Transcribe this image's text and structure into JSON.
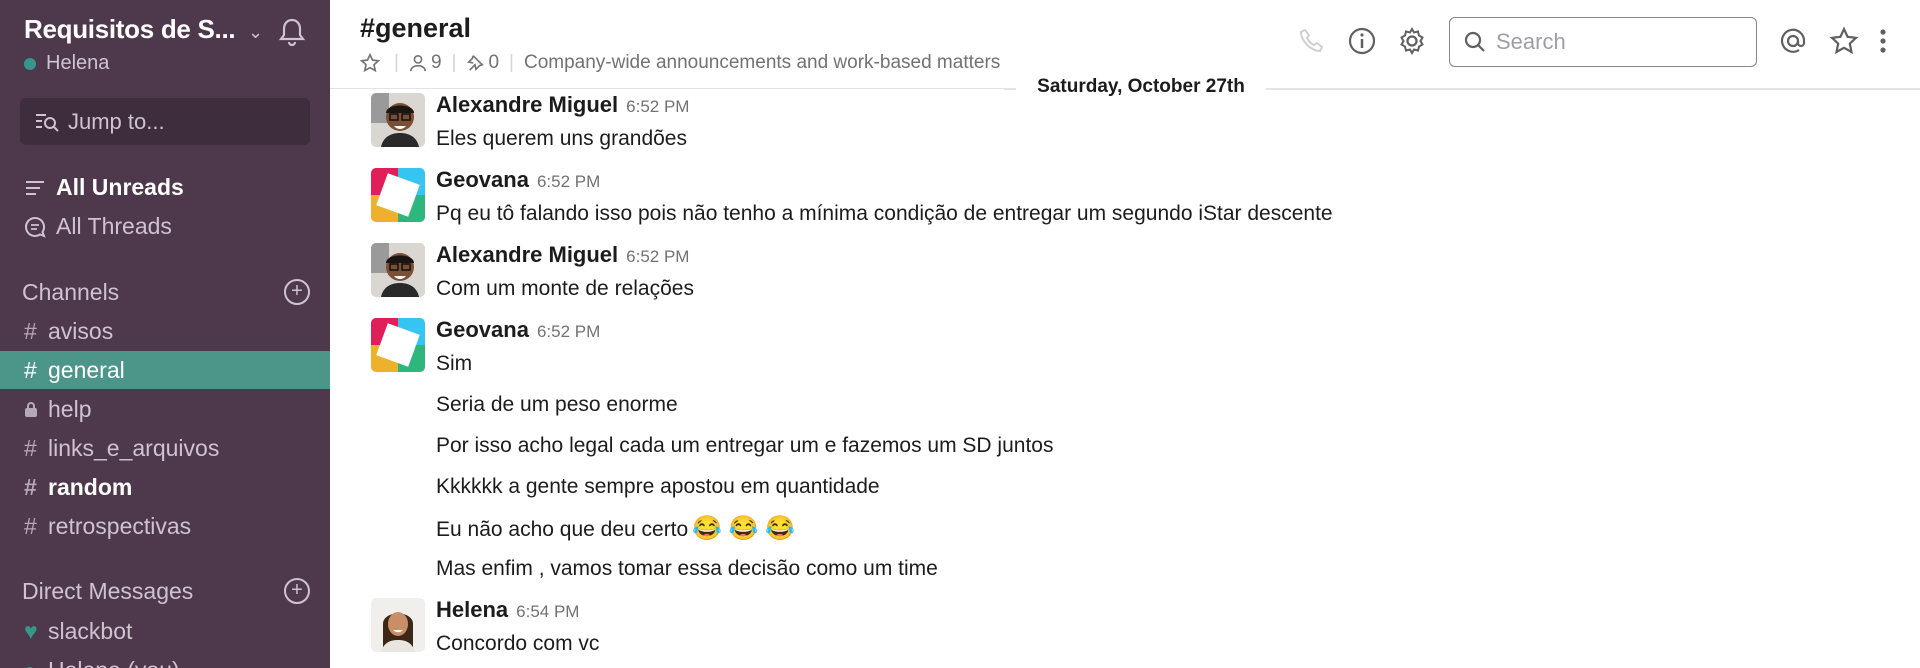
{
  "team": {
    "name": "Requisitos de S...",
    "user": "Helena"
  },
  "jump": {
    "label": "Jump to..."
  },
  "nav": {
    "all_unreads": "All Unreads",
    "all_threads": "All Threads"
  },
  "channels_section": {
    "title": "Channels"
  },
  "channels": [
    {
      "name": "avisos",
      "type": "public",
      "state": "normal"
    },
    {
      "name": "general",
      "type": "public",
      "state": "active"
    },
    {
      "name": "help",
      "type": "private",
      "state": "normal"
    },
    {
      "name": "links_e_arquivos",
      "type": "public",
      "state": "normal"
    },
    {
      "name": "random",
      "type": "public",
      "state": "unread"
    },
    {
      "name": "retrospectivas",
      "type": "public",
      "state": "normal"
    }
  ],
  "dm_section": {
    "title": "Direct Messages"
  },
  "dms": [
    {
      "name": "slackbot",
      "icon": "heart-icon"
    },
    {
      "name": "Helena (you)",
      "icon": "presence-dot"
    }
  ],
  "header": {
    "channel": "#general",
    "members": "9",
    "pins": "0",
    "topic": "Company-wide announcements and work-based matters",
    "search_placeholder": "Search"
  },
  "date_divider": "Saturday, October 27th",
  "messages": [
    {
      "author": "Alexandre Miguel",
      "time": "6:52 PM",
      "avatar": "photo",
      "lines": [
        "Eles querem uns grandões"
      ]
    },
    {
      "author": "Geovana",
      "time": "6:52 PM",
      "avatar": "slack-logo",
      "lines": [
        "Pq eu tô falando isso pois não tenho a mínima condição de entregar um segundo iStar descente"
      ]
    },
    {
      "author": "Alexandre Miguel",
      "time": "6:52 PM",
      "avatar": "photo",
      "lines": [
        "Com um monte de relações"
      ]
    },
    {
      "author": "Geovana",
      "time": "6:52 PM",
      "avatar": "slack-logo",
      "lines": [
        "Sim",
        "Seria de um peso enorme",
        "Por isso acho legal cada um entregar um e fazemos um SD juntos",
        "Kkkkkk a gente sempre apostou em quantidade",
        "Eu não acho que deu certo",
        "Mas enfim , vamos tomar essa decisão como um time"
      ],
      "emoji": "😂 😂 😂"
    },
    {
      "author": "Helena",
      "time": "6:54 PM",
      "avatar": "photo",
      "lines": [
        "Concordo com vc"
      ]
    }
  ],
  "colors": {
    "sidebar": "#4d394b",
    "active": "#4c9689",
    "presence": "#38978d"
  }
}
